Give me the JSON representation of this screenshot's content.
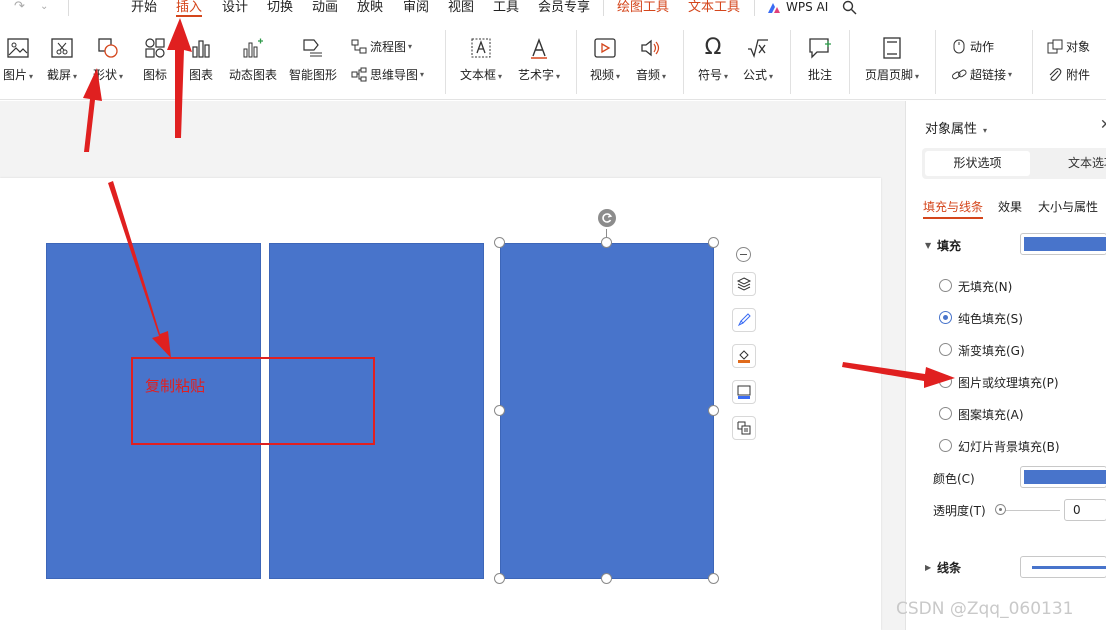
{
  "menu": {
    "items": [
      "开始",
      "插入",
      "设计",
      "切换",
      "动画",
      "放映",
      "审阅",
      "视图",
      "工具",
      "会员专享"
    ],
    "active": "插入",
    "context_tabs": [
      "绘图工具",
      "文本工具"
    ],
    "wps_ai": "WPS AI"
  },
  "ribbon": {
    "picture": "图片",
    "screenshot": "截屏",
    "shapes": "形状",
    "icons": "图标",
    "chart": "图表",
    "dynamic_chart": "动态图表",
    "smart_graphic": "智能图形",
    "flowchart": "流程图",
    "mindmap": "思维导图",
    "textbox": "文本框",
    "wordart": "艺术字",
    "video": "视频",
    "audio": "音频",
    "symbol": "符号",
    "formula": "公式",
    "comment": "批注",
    "header_footer": "页眉页脚",
    "action": "动作",
    "hyperlink": "超链接",
    "object": "对象",
    "attachment": "附件"
  },
  "annotation": {
    "text": "复制粘贴",
    "color": "#e02020"
  },
  "shape_color": "#4874cb",
  "panel": {
    "title": "对象属性",
    "tabs": [
      "形状选项",
      "文本选项"
    ],
    "subtabs": [
      "填充与线条",
      "效果",
      "大小与属性"
    ],
    "fill_section": "填充",
    "fill_options": [
      {
        "label": "无填充(N)",
        "selected": false
      },
      {
        "label": "纯色填充(S)",
        "selected": true
      },
      {
        "label": "渐变填充(G)",
        "selected": false
      },
      {
        "label": "图片或纹理填充(P)",
        "selected": false
      },
      {
        "label": "图案填充(A)",
        "selected": false
      },
      {
        "label": "幻灯片背景填充(B)",
        "selected": false
      }
    ],
    "color_label": "颜色(C)",
    "opacity_label": "透明度(T)",
    "opacity_value": "0",
    "line_section": "线条"
  },
  "watermark": "CSDN @Zqq_060131"
}
